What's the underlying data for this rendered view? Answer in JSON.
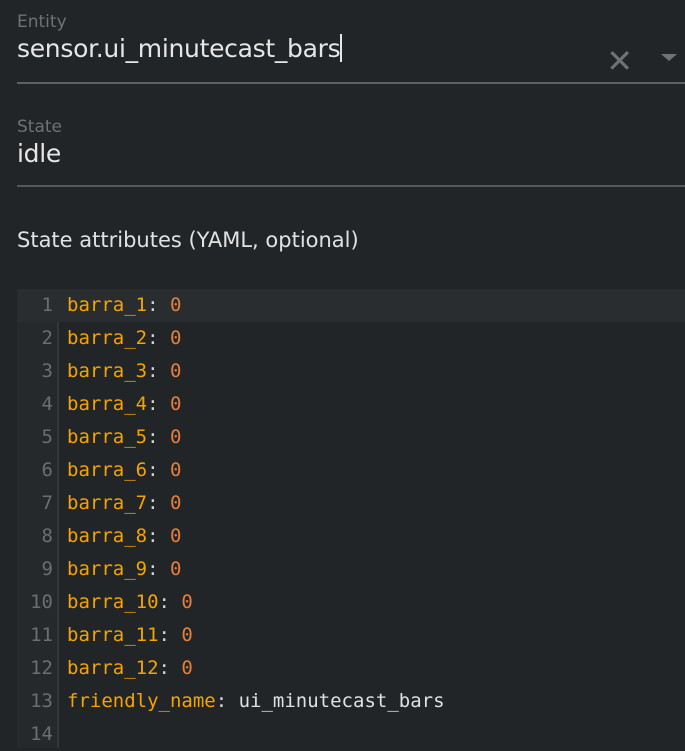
{
  "entity": {
    "label": "Entity",
    "value": "sensor.ui_minutecast_bars",
    "clear_icon": "close-icon",
    "dropdown_icon": "caret-down-icon"
  },
  "state": {
    "label": "State",
    "value": "idle"
  },
  "attributes": {
    "label": "State attributes (YAML, optional)",
    "lines": [
      {
        "n": "1",
        "key": "barra_1",
        "value": "0",
        "type": "num"
      },
      {
        "n": "2",
        "key": "barra_2",
        "value": "0",
        "type": "num"
      },
      {
        "n": "3",
        "key": "barra_3",
        "value": "0",
        "type": "num"
      },
      {
        "n": "4",
        "key": "barra_4",
        "value": "0",
        "type": "num"
      },
      {
        "n": "5",
        "key": "barra_5",
        "value": "0",
        "type": "num"
      },
      {
        "n": "6",
        "key": "barra_6",
        "value": "0",
        "type": "num"
      },
      {
        "n": "7",
        "key": "barra_7",
        "value": "0",
        "type": "num"
      },
      {
        "n": "8",
        "key": "barra_8",
        "value": "0",
        "type": "num"
      },
      {
        "n": "9",
        "key": "barra_9",
        "value": "0",
        "type": "num"
      },
      {
        "n": "10",
        "key": "barra_10",
        "value": "0",
        "type": "num"
      },
      {
        "n": "11",
        "key": "barra_11",
        "value": "0",
        "type": "num"
      },
      {
        "n": "12",
        "key": "barra_12",
        "value": "0",
        "type": "num"
      },
      {
        "n": "13",
        "key": "friendly_name",
        "value": "ui_minutecast_bars",
        "type": "str"
      },
      {
        "n": "14",
        "key": "",
        "value": "",
        "type": "empty"
      }
    ]
  }
}
